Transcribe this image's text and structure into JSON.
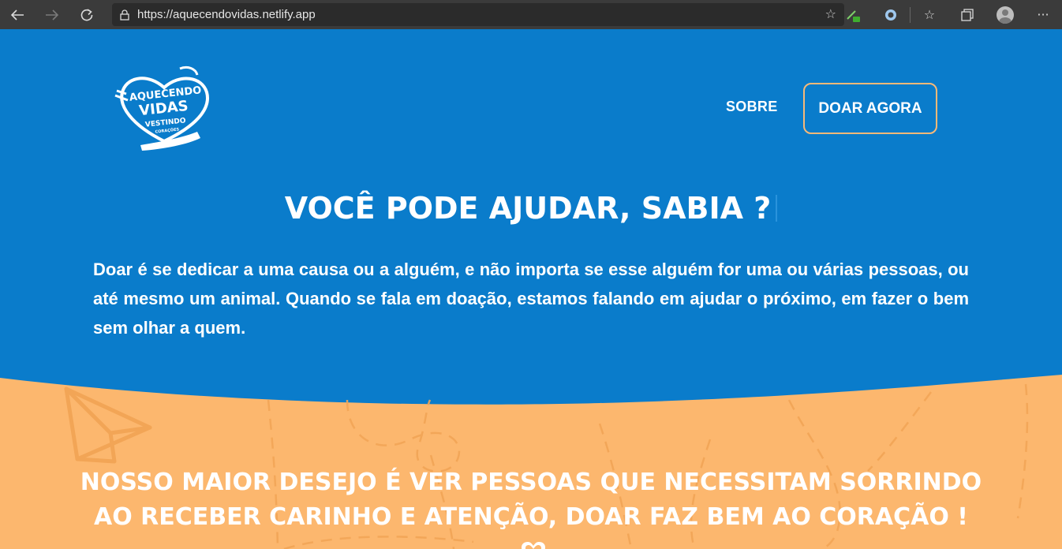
{
  "browser": {
    "url": "https://aquecendovidas.netlify.app",
    "icons": [
      "back-icon",
      "forward-icon",
      "refresh-icon",
      "lock-icon",
      "favorite-star-icon",
      "extension-icon",
      "extension-circle-icon",
      "favorites-list-icon",
      "collections-icon",
      "profile-avatar",
      "more-icon"
    ]
  },
  "logo": {
    "text_line1": "AQUECENDO",
    "text_line2": "VIDAS",
    "text_line3": "VESTINDO",
    "text_line4": "CORAÇÕES"
  },
  "nav": {
    "sobre": "SOBRE",
    "doar": "DOAR AGORA"
  },
  "hero": {
    "headline": "VOCÊ PODE AJUDAR, SABIA ?",
    "paragraph": "Doar é se dedicar a uma causa ou a alguém, e não importa se esse alguém for uma ou várias pessoas, ou até mesmo um animal. Quando se fala em doação, estamos falando em ajudar o próximo, em fazer o bem sem olhar a quem."
  },
  "banner": {
    "line1": "NOSSO MAIOR DESEJO É VER PESSOAS QUE NECESSITAM SORRINDO",
    "line2": "AO RECEBER CARINHO E ATENÇÃO, DOAR FAZ BEM AO CORAÇÃO !"
  },
  "colors": {
    "blue": "#0a7ccb",
    "orange": "#fcb76e",
    "orange_line": "#f2a556",
    "button_border": "#f7b978"
  }
}
